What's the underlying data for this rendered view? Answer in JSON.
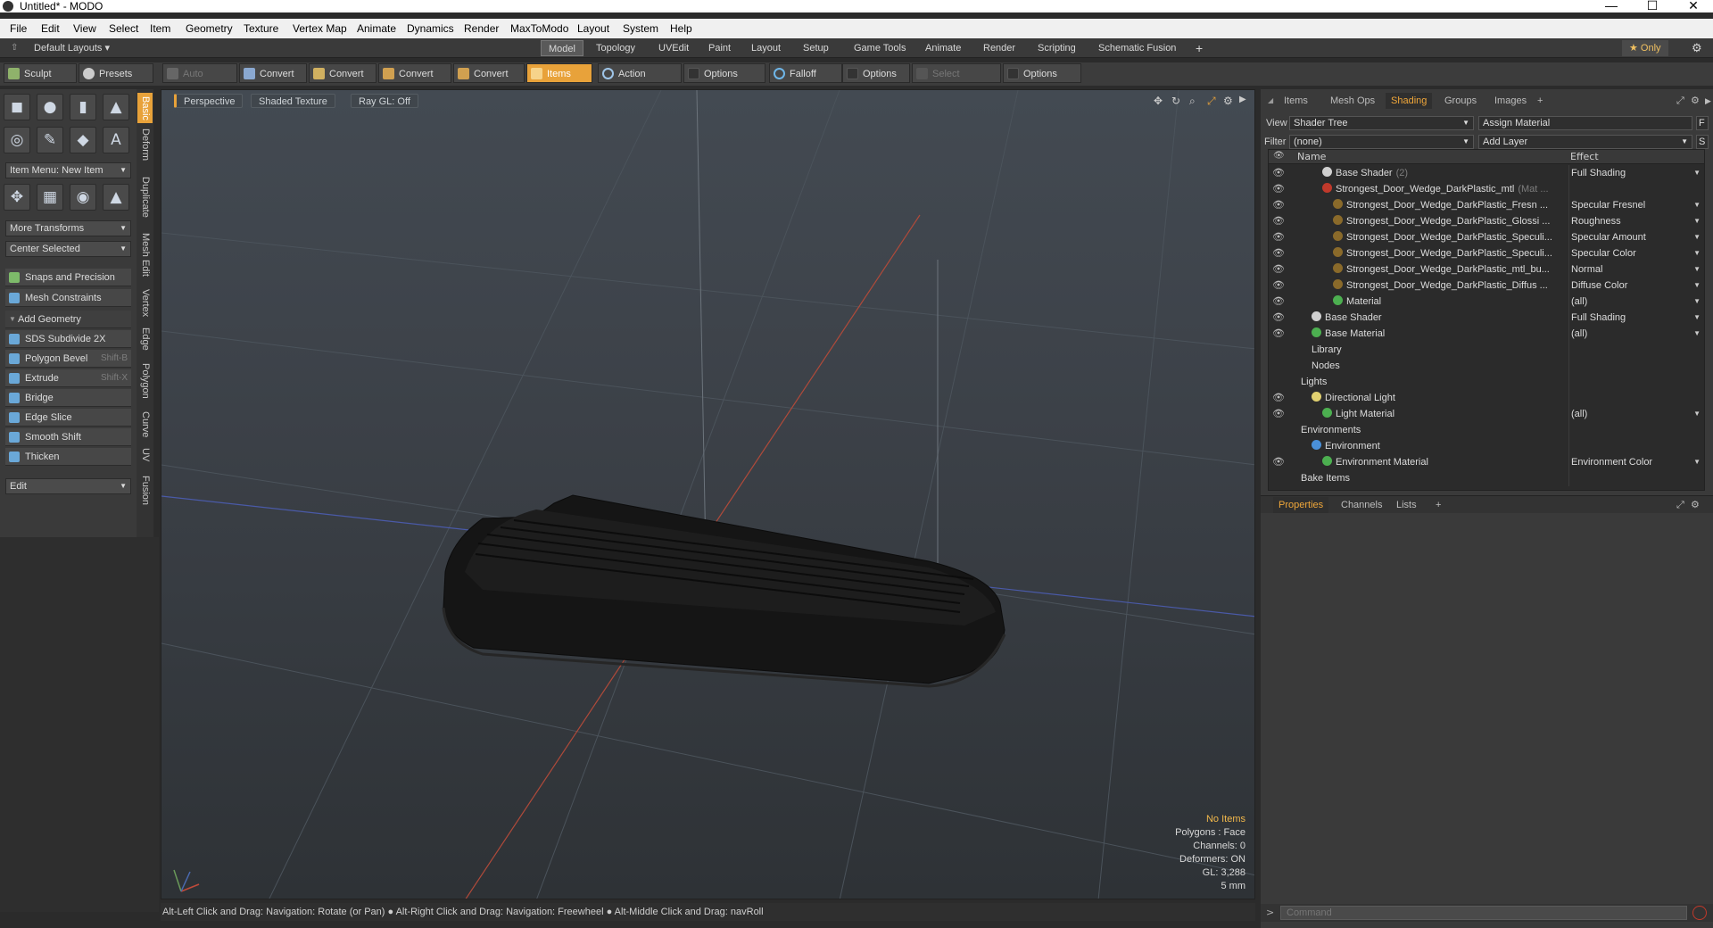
{
  "window": {
    "title": "Untitled* - MODO",
    "minimize": "—",
    "maximize": "☐",
    "close": "✕"
  },
  "menu": [
    "File",
    "Edit",
    "View",
    "Select",
    "Item",
    "Geometry",
    "Texture",
    "Vertex Map",
    "Animate",
    "Dynamics",
    "Render",
    "MaxToModo",
    "Layout",
    "System",
    "Help"
  ],
  "layout_row": {
    "default_layouts": "Default Layouts",
    "tabs": [
      "Model",
      "Topology",
      "UVEdit",
      "Paint",
      "Layout",
      "Setup",
      "Game Tools",
      "Animate",
      "Render",
      "Scripting",
      "Schematic Fusion"
    ],
    "active_tab": "Model",
    "plus": "+",
    "only": "Only"
  },
  "toolbar": {
    "sculpt": "Sculpt",
    "presets": "Presets",
    "presets_key": "F6",
    "auto_select": "Auto Select",
    "convert1": "Convert",
    "convert2": "Convert",
    "convert3": "Convert",
    "convert4": "Convert",
    "items": "Items",
    "action_center": "Action Center",
    "options1": "Options",
    "falloff": "Falloff",
    "options2": "Options",
    "select_through": "Select Through",
    "options3": "Options"
  },
  "left": {
    "item_menu": "Item Menu: New Item",
    "more_transforms": "More Transforms",
    "center_selected": "Center Selected",
    "snaps": "Snaps and Precision",
    "mesh_constraints": "Mesh Constraints",
    "add_geometry": "Add Geometry",
    "tools": [
      {
        "label": "SDS Subdivide 2X",
        "key": ""
      },
      {
        "label": "Polygon Bevel",
        "key": "Shift-B"
      },
      {
        "label": "Extrude",
        "key": "Shift-X"
      },
      {
        "label": "Bridge",
        "key": ""
      },
      {
        "label": "Edge Slice",
        "key": ""
      },
      {
        "label": "Smooth Shift",
        "key": ""
      },
      {
        "label": "Thicken",
        "key": ""
      }
    ],
    "edit": "Edit",
    "vtabs": [
      "Basic",
      "Deform",
      "Duplicate",
      "Mesh Edit",
      "Vertex",
      "Edge",
      "Polygon",
      "Curve",
      "UV",
      "Fusion"
    ]
  },
  "viewport": {
    "perspective": "Perspective",
    "shaded_texture": "Shaded Texture",
    "ray_gl": "Ray GL: Off",
    "stats": {
      "items": "No Items",
      "polygons": "Polygons : Face",
      "channels": "Channels: 0",
      "deformers": "Deformers: ON",
      "gl": "GL: 3,288",
      "scale": "5 mm"
    },
    "axis_x": "X",
    "axis_y": "Y",
    "axis_z": "Z"
  },
  "statusbar": "Alt-Left Click and Drag: Navigation: Rotate (or Pan) ● Alt-Right Click and Drag: Navigation: Freewheel ● Alt-Middle Click and Drag: navRoll",
  "right": {
    "tabs": [
      "Items",
      "Mesh Ops",
      "Shading",
      "Groups",
      "Images"
    ],
    "active_tab": "Shading",
    "plus": "+",
    "view_label": "View",
    "view_value": "Shader Tree",
    "assign_material": "Assign Material",
    "filter_label": "Filter",
    "filter_value": "(none)",
    "add_layer": "Add Layer",
    "f_btn": "F",
    "s_btn": "S",
    "col_name": "Name",
    "col_effect": "Effect",
    "rows": [
      {
        "name": "Base Shader",
        "suffix": "(2)",
        "effect": "Full Shading",
        "indent": 3,
        "icon": "#d0d0d0",
        "eye": true
      },
      {
        "name": "Strongest_Door_Wedge_DarkPlastic_mtl",
        "suffix": "(Mat ...",
        "effect": "",
        "indent": 3,
        "icon": "#c0392b",
        "eye": true
      },
      {
        "name": "Strongest_Door_Wedge_DarkPlastic_Fresn ...",
        "suffix": "",
        "effect": "Specular Fresnel",
        "indent": 4,
        "icon": "#8a6a2a",
        "eye": true
      },
      {
        "name": "Strongest_Door_Wedge_DarkPlastic_Glossi ...",
        "suffix": "",
        "effect": "Roughness",
        "indent": 4,
        "icon": "#8a6a2a",
        "eye": true
      },
      {
        "name": "Strongest_Door_Wedge_DarkPlastic_Speculi...",
        "suffix": "",
        "effect": "Specular Amount",
        "indent": 4,
        "icon": "#8a6a2a",
        "eye": true
      },
      {
        "name": "Strongest_Door_Wedge_DarkPlastic_Speculi...",
        "suffix": "",
        "effect": "Specular Color",
        "indent": 4,
        "icon": "#8a6a2a",
        "eye": true
      },
      {
        "name": "Strongest_Door_Wedge_DarkPlastic_mtl_bu...",
        "suffix": "",
        "effect": "Normal",
        "indent": 4,
        "icon": "#8a6a2a",
        "eye": true
      },
      {
        "name": "Strongest_Door_Wedge_DarkPlastic_Diffus ...",
        "suffix": "",
        "effect": "Diffuse Color",
        "indent": 4,
        "icon": "#8a6a2a",
        "eye": true
      },
      {
        "name": "Material",
        "suffix": "",
        "effect": "(all)",
        "indent": 4,
        "icon": "#4caf50",
        "eye": true
      },
      {
        "name": "Base Shader",
        "suffix": "",
        "effect": "Full Shading",
        "indent": 2,
        "icon": "#d0d0d0",
        "eye": true
      },
      {
        "name": "Base Material",
        "suffix": "",
        "effect": "(all)",
        "indent": 2,
        "icon": "#4caf50",
        "eye": true
      },
      {
        "name": "Library",
        "suffix": "",
        "effect": "",
        "indent": 2,
        "icon": "",
        "eye": false
      },
      {
        "name": "Nodes",
        "suffix": "",
        "effect": "",
        "indent": 2,
        "icon": "",
        "eye": false
      },
      {
        "name": "Lights",
        "suffix": "",
        "effect": "",
        "indent": 1,
        "icon": "",
        "eye": false
      },
      {
        "name": "Directional Light",
        "suffix": "",
        "effect": "",
        "indent": 2,
        "icon": "#e0d070",
        "eye": true
      },
      {
        "name": "Light Material",
        "suffix": "",
        "effect": "(all)",
        "indent": 3,
        "icon": "#4caf50",
        "eye": true
      },
      {
        "name": "Environments",
        "suffix": "",
        "effect": "",
        "indent": 1,
        "icon": "",
        "eye": false
      },
      {
        "name": "Environment",
        "suffix": "",
        "effect": "",
        "indent": 2,
        "icon": "#4a90d9",
        "eye": false
      },
      {
        "name": "Environment Material",
        "suffix": "",
        "effect": "Environment Color",
        "indent": 3,
        "icon": "#4caf50",
        "eye": true
      },
      {
        "name": "Bake Items",
        "suffix": "",
        "effect": "",
        "indent": 1,
        "icon": "",
        "eye": false
      }
    ],
    "prop_tabs": [
      "Properties",
      "Channels",
      "Lists"
    ],
    "command_placeholder": "Command"
  }
}
